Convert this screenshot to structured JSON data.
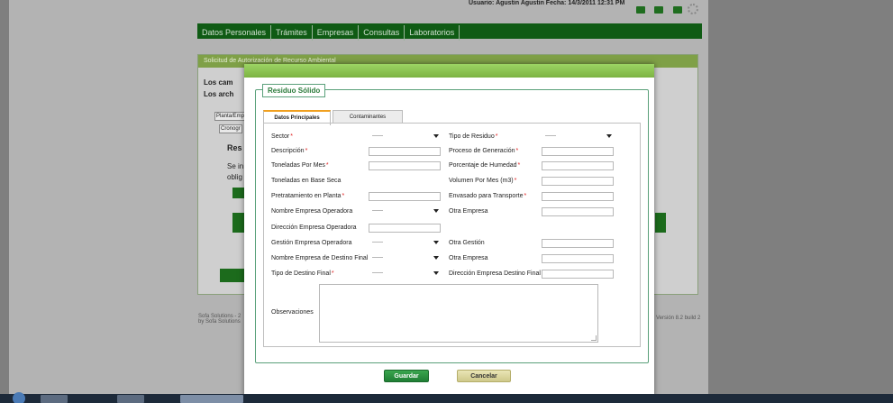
{
  "top": {
    "user_text": "Usuario: Agustin Agustin   Fecha: 14/3/2011 12:31 PM"
  },
  "nav": [
    "Datos Personales",
    "Trámites",
    "Empresas",
    "Consultas",
    "Laboratorios"
  ],
  "background": {
    "panel_title": "Solicitud de Autorización de Recurso Ambiental",
    "text1": "Los cam",
    "text2": "Los arch",
    "tab1": "Planta/Emp",
    "tab2": "Cronogr",
    "sub_heading": "Res",
    "sub_text1": "Se in",
    "sub_text2": "oblig",
    "footer_left": "Sofa Solutions - 2\nby Sofa Solutions",
    "footer_right": "Versión 8.2 build 2"
  },
  "modal": {
    "fieldset_title": "Residuo Sólido",
    "tabs": [
      {
        "label": "Datos Principales",
        "active": true
      },
      {
        "label": "Contaminantes",
        "active": false
      }
    ],
    "fields_left": [
      {
        "label": "Sector",
        "required": true,
        "type": "select",
        "value": "------"
      },
      {
        "label": "Descripción",
        "required": true,
        "type": "input",
        "value": ""
      },
      {
        "label": "Toneladas Por Mes",
        "required": true,
        "type": "input",
        "value": ""
      },
      {
        "label": "Toneladas en Base Seca",
        "required": false,
        "type": "none",
        "value": ""
      },
      {
        "label": "Pretratamiento en Planta",
        "required": true,
        "type": "input",
        "value": ""
      },
      {
        "label": "Nombre Empresa Operadora",
        "required": false,
        "type": "select",
        "value": "------"
      },
      {
        "label": "Dirección Empresa Operadora",
        "required": false,
        "type": "input",
        "value": ""
      },
      {
        "label": "Gestión Empresa Operadora",
        "required": false,
        "type": "select",
        "value": "------"
      },
      {
        "label": "Nombre Empresa de Destino Final",
        "required": false,
        "type": "select",
        "value": "------"
      },
      {
        "label": "Tipo de Destino Final",
        "required": true,
        "type": "select",
        "value": "------"
      }
    ],
    "fields_right": [
      {
        "label": "Tipo de Residuo",
        "required": true,
        "type": "select",
        "value": "------"
      },
      {
        "label": "Proceso de Generación",
        "required": true,
        "type": "input",
        "value": ""
      },
      {
        "label": "Porcentaje de Humedad",
        "required": true,
        "type": "input",
        "value": ""
      },
      {
        "label": "Volumen Por Mes (m3)",
        "required": true,
        "type": "input",
        "value": ""
      },
      {
        "label": "Envasado para Transporte",
        "required": true,
        "type": "input",
        "value": ""
      },
      {
        "label": "Otra Empresa",
        "required": false,
        "type": "input",
        "value": ""
      },
      {
        "label": "",
        "required": false,
        "type": "none",
        "value": ""
      },
      {
        "label": "Otra Gestión",
        "required": false,
        "type": "input",
        "value": ""
      },
      {
        "label": "Otra Empresa",
        "required": false,
        "type": "input",
        "value": ""
      },
      {
        "label": "Dirección Empresa Destino Final",
        "required": false,
        "type": "input",
        "value": ""
      }
    ],
    "observations_label": "Observaciones",
    "observations_value": "",
    "save_label": "Guardar",
    "cancel_label": "Cancelar"
  }
}
